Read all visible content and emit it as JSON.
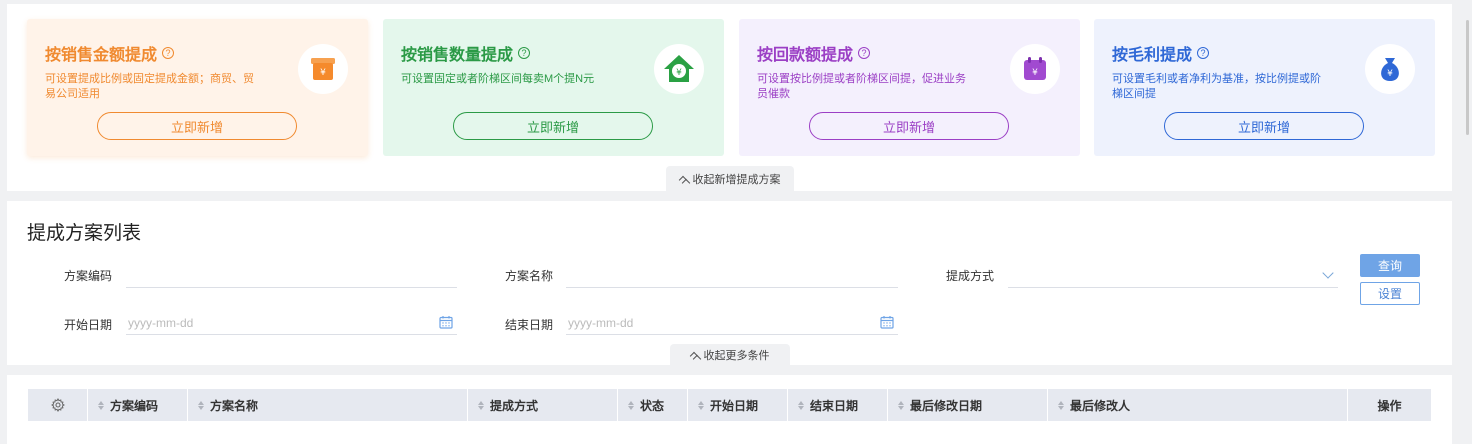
{
  "cards": [
    {
      "title": "按销售金额提成",
      "help": "?",
      "desc": "可设置提成比例或固定提成金额；商贸、贸易公司适用",
      "button": "立即新增",
      "icon": "yuan-box-icon",
      "bg": "#fff3e9",
      "title_color": "#f08a30",
      "desc_color": "#f08a30",
      "btn_color": "#f08a30"
    },
    {
      "title": "按销售数量提成",
      "help": "?",
      "desc": "可设置固定或者阶梯区间每卖M个提N元",
      "button": "立即新增",
      "icon": "yuan-house-icon",
      "bg": "#e4f7ec",
      "title_color": "#2b9a46",
      "desc_color": "#2b9a46",
      "btn_color": "#2b9a46"
    },
    {
      "title": "按回款额提成",
      "help": "?",
      "desc": "可设置按比例提或者阶梯区间提，促进业务员催款",
      "button": "立即新增",
      "icon": "yuan-calendar-icon",
      "bg": "#f4f0fd",
      "title_color": "#9b3fc5",
      "desc_color": "#9b3fc5",
      "btn_color": "#9b3fc5"
    },
    {
      "title": "按毛利提成",
      "help": "?",
      "desc": "可设置毛利或者净利为基准，按比例提或阶梯区间提",
      "button": "立即新增",
      "icon": "money-bag-icon",
      "bg": "#eef2fd",
      "title_color": "#2f68d6",
      "desc_color": "#2f68d6",
      "btn_color": "#2f68d6"
    }
  ],
  "collapse_label": "收起新增提成方案",
  "search": {
    "title": "提成方案列表",
    "code_label": "方案编码",
    "name_label": "方案名称",
    "method_label": "提成方式",
    "start_label": "开始日期",
    "end_label": "结束日期",
    "date_placeholder": "yyyy-mm-dd",
    "query_button": "查询",
    "settings_button": "设置",
    "more_label": "收起更多条件"
  },
  "table": {
    "columns": [
      "方案编码",
      "方案名称",
      "提成方式",
      "状态",
      "开始日期",
      "结束日期",
      "最后修改日期",
      "最后修改人",
      "操作"
    ]
  },
  "colors": {
    "accent": "#6fa4e6",
    "header_bg": "#e6e9f0",
    "page_bg": "#f0f1f3"
  }
}
